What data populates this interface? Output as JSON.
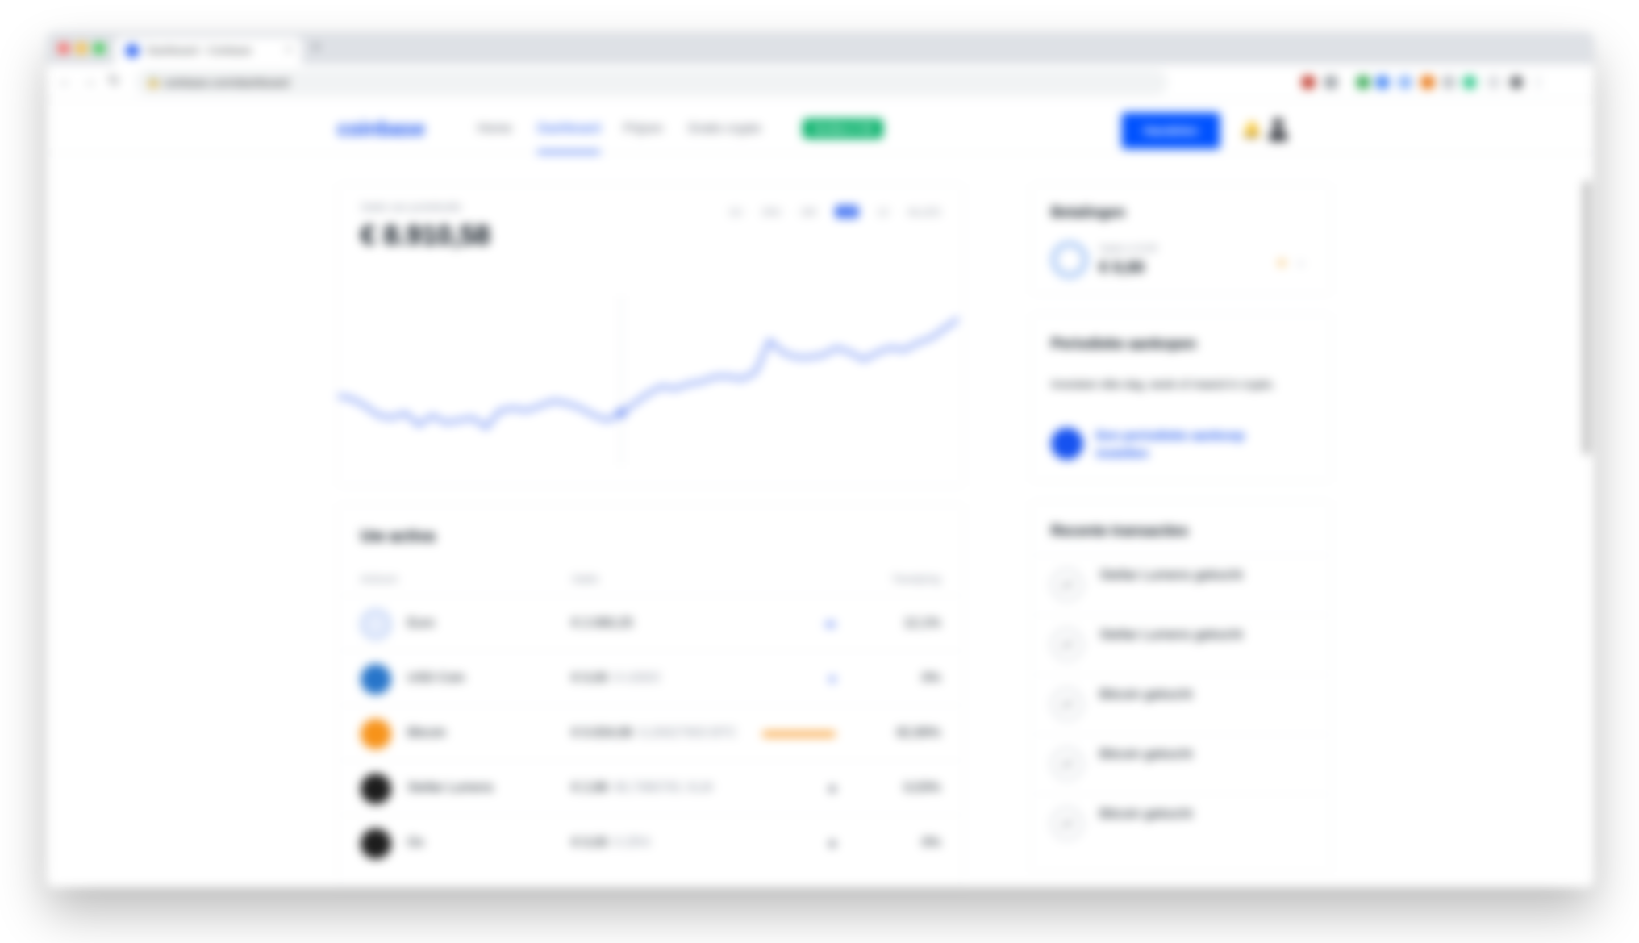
{
  "browser": {
    "tab_title": "Dashboard - Coinbase",
    "tab_close": "×",
    "new_tab": "+",
    "back": "←",
    "forward": "→",
    "reload": "↻",
    "lock": "🔒",
    "url": "coinbase.com/dashboard"
  },
  "nav": {
    "logo": "coinbase",
    "items": [
      "Home",
      "Dashboard",
      "Prijzen",
      "Gratis crypto"
    ],
    "active_index": 1,
    "badge": "Verdien € 50",
    "trade_button": "Handelen"
  },
  "portfolio": {
    "label": "Saldo van portefeuille",
    "value": "€ 8.910,58",
    "ranges": [
      "1U",
      "24U",
      "1W",
      "1M",
      "1J",
      "ALLES"
    ],
    "active_range": 3
  },
  "chart_data": {
    "type": "line",
    "title": "",
    "color": "#6f8ff5",
    "x": [
      "",
      "",
      "",
      "",
      "",
      "",
      ""
    ],
    "values": [
      52,
      51,
      48,
      44,
      43,
      45,
      40,
      44,
      41,
      42,
      43,
      39,
      46,
      47,
      46,
      48,
      50,
      49,
      47,
      44,
      42,
      45,
      49,
      53,
      56,
      55,
      57,
      58,
      60,
      60,
      59,
      62,
      75,
      70,
      68,
      68,
      69,
      72,
      70,
      67,
      70,
      72,
      71,
      74,
      76,
      80,
      84
    ],
    "hover_index": 21,
    "hover_label": "",
    "ylim": [
      30,
      90
    ]
  },
  "assets": {
    "title": "Uw activa",
    "headers": [
      "Activum",
      "Saldo",
      "Toewijzing"
    ],
    "rows": [
      {
        "name": "Euro",
        "balance": "€ 2.060,25",
        "sub": "",
        "alloc": 0.121,
        "pct": "12,1%",
        "color": "#a8c0f0"
      },
      {
        "name": "USD Coin",
        "balance": "€ 0,00",
        "sub": "0 USDC",
        "alloc": 0.0,
        "pct": "0%",
        "color": "#2775ca"
      },
      {
        "name": "Bitcoin",
        "balance": "€ 6.834,86",
        "sub": "0,20027903 BTC",
        "alloc": 0.8289,
        "pct": "82,89%",
        "color": "#f7931a"
      },
      {
        "name": "Stellar Lumens",
        "balance": "€ 2,88",
        "sub": "80,7980781 XLM",
        "alloc": 0.0,
        "pct": "0,03%",
        "color": "#1d1d1d"
      },
      {
        "name": "Ox",
        "balance": "€ 0,00",
        "sub": "0 ZRX",
        "alloc": 0.0,
        "pct": "0%",
        "color": "#1d1d1d"
      }
    ]
  },
  "wallets": {
    "title": "Betalingen",
    "label": "Saldo in EUR",
    "value": "€ 0,00",
    "star": "★",
    "chevron": "⌄"
  },
  "recurring": {
    "title": "Periodieke aankopen",
    "text": "Investeer elke dag, week of maand in crypto.",
    "link": "Een periodieke aankoop instellen"
  },
  "transactions": {
    "title": "Recente transacties",
    "items": [
      {
        "title": "Stellar Lumens gekocht",
        "sub": "",
        "icon": "⇄"
      },
      {
        "title": "Stellar Lumens gekocht",
        "sub": "",
        "icon": "⇄"
      },
      {
        "title": "Bitcoin gekocht",
        "sub": "",
        "icon": "⇄"
      },
      {
        "title": "Bitcoin gekocht",
        "sub": "",
        "icon": "⇄"
      },
      {
        "title": "Bitcoin gekocht",
        "sub": "",
        "icon": "⇄"
      }
    ]
  },
  "icons": {
    "bell": "🔔"
  }
}
